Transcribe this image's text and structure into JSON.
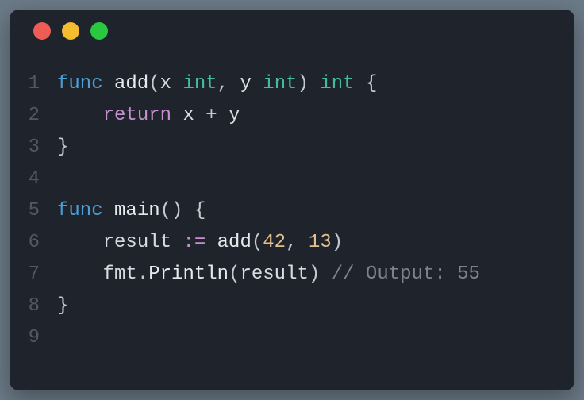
{
  "window": {
    "buttons": [
      "close",
      "minimize",
      "zoom"
    ]
  },
  "lines": [
    {
      "n": "1",
      "tokens": [
        {
          "t": "func",
          "c": "kw"
        },
        {
          "t": " ",
          "c": "punc"
        },
        {
          "t": "add",
          "c": "fn"
        },
        {
          "t": "(",
          "c": "punc"
        },
        {
          "t": "x",
          "c": "id"
        },
        {
          "t": " ",
          "c": "punc"
        },
        {
          "t": "int",
          "c": "type"
        },
        {
          "t": ",",
          "c": "punc"
        },
        {
          "t": " ",
          "c": "punc"
        },
        {
          "t": "y",
          "c": "id"
        },
        {
          "t": " ",
          "c": "punc"
        },
        {
          "t": "int",
          "c": "type"
        },
        {
          "t": ")",
          "c": "punc"
        },
        {
          "t": " ",
          "c": "punc"
        },
        {
          "t": "int",
          "c": "type"
        },
        {
          "t": " ",
          "c": "punc"
        },
        {
          "t": "{",
          "c": "punc"
        }
      ]
    },
    {
      "n": "2",
      "tokens": [
        {
          "t": "    ",
          "c": "punc"
        },
        {
          "t": "return",
          "c": "op"
        },
        {
          "t": " ",
          "c": "punc"
        },
        {
          "t": "x",
          "c": "id"
        },
        {
          "t": " ",
          "c": "punc"
        },
        {
          "t": "+",
          "c": "punc"
        },
        {
          "t": " ",
          "c": "punc"
        },
        {
          "t": "y",
          "c": "id"
        }
      ]
    },
    {
      "n": "3",
      "tokens": [
        {
          "t": "}",
          "c": "punc"
        }
      ]
    },
    {
      "n": "4",
      "tokens": []
    },
    {
      "n": "5",
      "tokens": [
        {
          "t": "func",
          "c": "kw"
        },
        {
          "t": " ",
          "c": "punc"
        },
        {
          "t": "main",
          "c": "fn"
        },
        {
          "t": "(",
          "c": "punc"
        },
        {
          "t": ")",
          "c": "punc"
        },
        {
          "t": " ",
          "c": "punc"
        },
        {
          "t": "{",
          "c": "punc"
        }
      ]
    },
    {
      "n": "6",
      "tokens": [
        {
          "t": "    ",
          "c": "punc"
        },
        {
          "t": "result",
          "c": "id"
        },
        {
          "t": " ",
          "c": "punc"
        },
        {
          "t": ":=",
          "c": "def"
        },
        {
          "t": " ",
          "c": "punc"
        },
        {
          "t": "add",
          "c": "fn"
        },
        {
          "t": "(",
          "c": "punc"
        },
        {
          "t": "42",
          "c": "num"
        },
        {
          "t": ",",
          "c": "punc"
        },
        {
          "t": " ",
          "c": "punc"
        },
        {
          "t": "13",
          "c": "num"
        },
        {
          "t": ")",
          "c": "punc"
        }
      ]
    },
    {
      "n": "7",
      "tokens": [
        {
          "t": "    ",
          "c": "punc"
        },
        {
          "t": "fmt",
          "c": "id"
        },
        {
          "t": ".",
          "c": "punc"
        },
        {
          "t": "Println",
          "c": "fn"
        },
        {
          "t": "(",
          "c": "punc"
        },
        {
          "t": "result",
          "c": "id"
        },
        {
          "t": ")",
          "c": "punc"
        },
        {
          "t": " ",
          "c": "punc"
        },
        {
          "t": "// Output: 55",
          "c": "comment"
        }
      ]
    },
    {
      "n": "8",
      "tokens": [
        {
          "t": "}",
          "c": "punc"
        }
      ]
    },
    {
      "n": "9",
      "tokens": []
    }
  ]
}
